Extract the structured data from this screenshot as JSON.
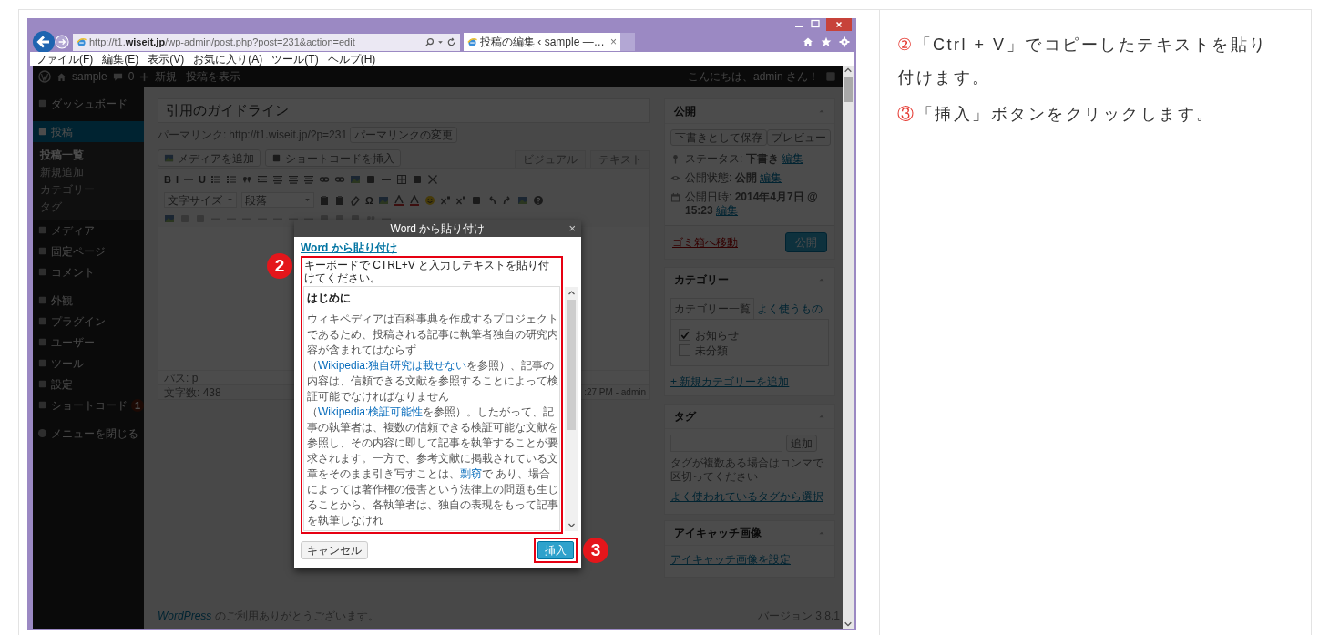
{
  "browser": {
    "url": "http://t1.**wiseit.jp**/wp-admin/post.php?post=231&action=edit",
    "tabs": [
      {
        "title": "投稿の編集 ‹ sample —…",
        "close": "×",
        "selected": true
      }
    ],
    "menu": [
      "ファイル(F)",
      "編集(E)",
      "表示(V)",
      "お気に入り(A)",
      "ツール(T)",
      "ヘルプ(H)"
    ]
  },
  "admin_bar": {
    "site": "sample",
    "comments": "0",
    "new": "新規",
    "view_post": "投稿を表示",
    "greeting": "こんにちは、admin さん！"
  },
  "sidebar": {
    "groups": [
      {
        "items": [
          {
            "label": "ダッシュボード",
            "selected": false
          }
        ]
      },
      {
        "items": [
          {
            "label": "投稿",
            "selected": true,
            "children": [
              {
                "label": "投稿一覧",
                "selected": true
              },
              {
                "label": "新規追加",
                "selected": false
              },
              {
                "label": "カテゴリー",
                "selected": false
              },
              {
                "label": "タグ",
                "selected": false
              }
            ]
          },
          {
            "label": "メディア",
            "selected": false
          },
          {
            "label": "固定ページ",
            "selected": false
          },
          {
            "label": "コメント",
            "selected": false
          }
        ]
      },
      {
        "items": [
          {
            "label": "外観",
            "selected": false
          },
          {
            "label": "プラグイン",
            "selected": false
          },
          {
            "label": "ユーザー",
            "selected": false
          },
          {
            "label": "ツール",
            "selected": false
          },
          {
            "label": "設定",
            "selected": false
          },
          {
            "label": "ショートコード",
            "selected": false,
            "badge": "1"
          }
        ]
      }
    ],
    "collapse": "メニューを閉じる"
  },
  "editor": {
    "title": "引用のガイドライン",
    "permalink_label": "パーマリンク:",
    "permalink": "http://t1.wiseit.jp/?p=231",
    "permalink_button": "パーマリンクの変更",
    "media_buttons": [
      "メディアを追加",
      "ショートコードを挿入"
    ],
    "tabs": [
      "ビジュアル",
      "テキスト"
    ],
    "toolbar": [
      [
        {
          "kind": "glyph",
          "text": "B"
        },
        {
          "kind": "glyph",
          "text": "I"
        },
        {
          "kind": "strike"
        },
        {
          "kind": "glyph",
          "text": "U"
        },
        {
          "kind": "list"
        },
        {
          "kind": "list"
        },
        {
          "kind": "quote"
        },
        {
          "kind": "indent"
        },
        {
          "kind": "align"
        },
        {
          "kind": "align"
        },
        {
          "kind": "align"
        },
        {
          "kind": "link"
        },
        {
          "kind": "link"
        },
        {
          "kind": "image"
        },
        {
          "kind": "square"
        },
        {
          "kind": "line"
        },
        {
          "kind": "table"
        },
        {
          "kind": "square"
        },
        {
          "kind": "expand"
        }
      ],
      [
        {
          "kind": "select",
          "text": "文字サイズ"
        },
        {
          "kind": "select",
          "text": "段落"
        },
        {
          "kind": "paste"
        },
        {
          "kind": "paste"
        },
        {
          "kind": "eraser"
        },
        {
          "kind": "glyph",
          "text": "Ω"
        },
        {
          "kind": "image"
        },
        {
          "kind": "color"
        },
        {
          "kind": "color"
        },
        {
          "kind": "smiley"
        },
        {
          "kind": "script"
        },
        {
          "kind": "script"
        },
        {
          "kind": "square"
        },
        {
          "kind": "undo"
        },
        {
          "kind": "redo"
        },
        {
          "kind": "image"
        },
        {
          "kind": "help"
        }
      ],
      [
        {
          "kind": "image"
        },
        {
          "kind": "square"
        },
        {
          "kind": "square"
        },
        {
          "kind": "line"
        },
        {
          "kind": "line"
        },
        {
          "kind": "line"
        },
        {
          "kind": "line"
        },
        {
          "kind": "line"
        },
        {
          "kind": "line"
        },
        {
          "kind": "line"
        },
        {
          "kind": "square"
        },
        {
          "kind": "square"
        },
        {
          "kind": "square"
        },
        {
          "kind": "quote"
        },
        {
          "kind": "line"
        }
      ]
    ],
    "path": "パス: p",
    "word_count": "文字数: 438",
    "last_edited": ":27 PM - admin"
  },
  "publish": {
    "title": "公開",
    "save_draft": "下書きとして保存",
    "preview": "プレビュー",
    "rows": [
      {
        "kind": "status",
        "label": "ステータス: **下書き**",
        "link": "編集"
      },
      {
        "kind": "visibility",
        "label": "公開状態: **公開**",
        "link": "編集"
      },
      {
        "kind": "date",
        "label": "公開日時: **2014年4月7日 @ 15:23**",
        "link": "編集"
      }
    ],
    "trash": "ゴミ箱へ移動",
    "publish": "公開"
  },
  "categories": {
    "title": "カテゴリー",
    "tabs": [
      {
        "label": "カテゴリー一覧",
        "selected": true
      },
      {
        "label": "よく使うもの",
        "selected": false
      }
    ],
    "items": [
      {
        "label": "お知らせ",
        "checked": true
      },
      {
        "label": "未分類",
        "checked": false
      }
    ],
    "add_link": "+ 新規カテゴリーを追加"
  },
  "tags": {
    "title": "タグ",
    "add": "追加",
    "hint": "タグが複数ある場合はコンマで区切ってください",
    "choose_link": "よく使われているタグから選択"
  },
  "featured_image": {
    "title": "アイキャッチ画像",
    "set_link": "アイキャッチ画像を設定"
  },
  "footer": {
    "thanks_link": "WordPress",
    "thanks": " のご利用ありがとうございます。",
    "version": "バージョン 3.8.1"
  },
  "dialog": {
    "title": "Word から貼り付け",
    "close": "×",
    "heading_link": "Word から貼り付け",
    "instruction": "キーボードで CTRL+V と入力しテキストを貼り付けてください。",
    "content_heading": "はじめに",
    "content": [
      {
        "text": "ウィキペディアは百科事典を作成するプロジェクトであるため、投稿される記事に執筆者独自の研究内容が含まれてはならず（",
        "link": false
      },
      {
        "text": "Wikipedia:独自研究は載せない",
        "link": true
      },
      {
        "text": "を参照）、記事の内容は、信頼できる文献を参照することによって検証可能でなければなりません（",
        "link": false
      },
      {
        "text": "Wikipedia:検証可能性",
        "link": true
      },
      {
        "text": "を参照）。したがって、記事の執筆者は、複数の信頼できる検証可能な文献を参照し、その内容に即して記事を執筆することが要求されます。一方で、参考文献に掲載されている文章をそのまま引き写すことは、",
        "link": false
      },
      {
        "text": "剽窃",
        "link": true
      },
      {
        "text": "で あり、場合によっては著作権の侵害という法律上の問題も生じることから、各執筆者は、独自の表現をもって記事を執筆しなけれ",
        "link": false
      }
    ],
    "cancel": "キャンセル",
    "insert": "挿入",
    "paste_marker": "2",
    "insert_marker": "3"
  },
  "steps": [
    {
      "number": "②",
      "text": "「Ctrl + V」でコピーしたテキストを貼り付けます。"
    },
    {
      "number": "③",
      "text": "「挿入」ボタンをクリックします。"
    }
  ]
}
